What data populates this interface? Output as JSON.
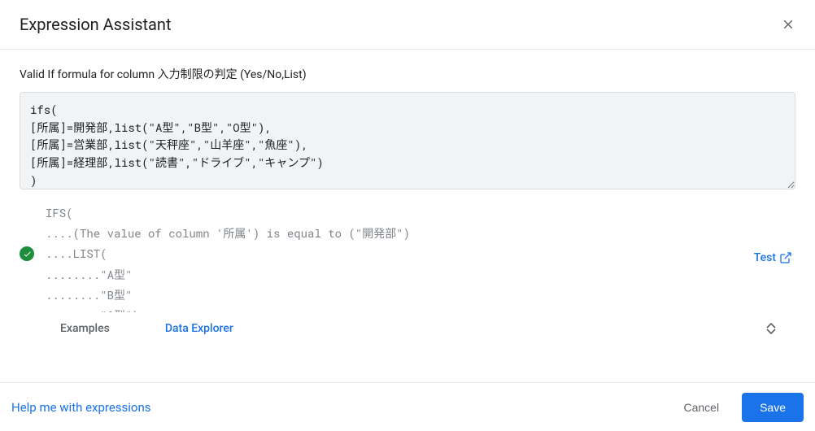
{
  "header": {
    "title": "Expression Assistant"
  },
  "subtitle": "Valid If formula for column 入力制限の判定 (Yes/No,List)",
  "formula": "ifs(\n[所属]=開発部,list(\"A型\",\"B型\",\"O型\"),\n[所属]=営業部,list(\"天秤座\",\"山羊座\",\"魚座\"),\n[所属]=経理部,list(\"読書\",\"ドライブ\",\"キャンプ\")\n)",
  "result_text": "IFS(\n....(The value of column '所属') is equal to (\"開発部\")\n....LIST(\n........\"A型\"\n........\"B型\"\n........\"O型\")",
  "test_label": "Test",
  "tabs": {
    "examples": "Examples",
    "data_explorer": "Data Explorer"
  },
  "footer": {
    "help": "Help me with expressions",
    "cancel": "Cancel",
    "save": "Save"
  }
}
